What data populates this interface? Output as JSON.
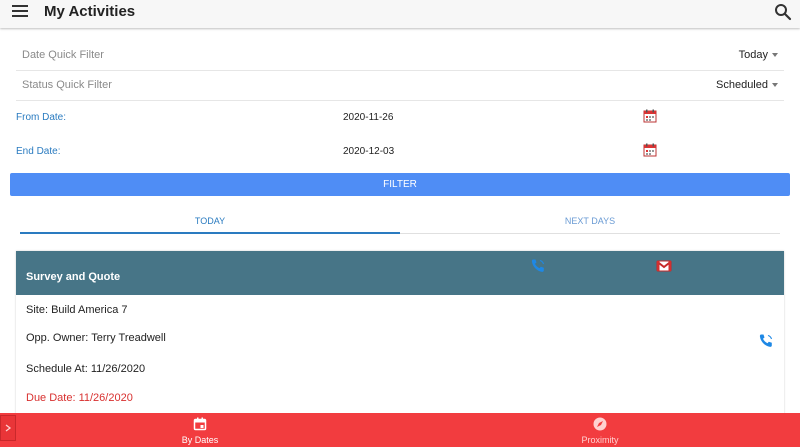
{
  "app": {
    "title": "My Activities"
  },
  "icons": {
    "menu": "menu-icon",
    "search": "search-icon",
    "calendar": "calendar-icon",
    "phone": "phone-icon",
    "mail": "mail-icon",
    "by_dates": "calendar-icon",
    "proximity": "compass-icon",
    "drawer": "chevron-right-icon"
  },
  "filters": {
    "date_quick": {
      "label": "Date Quick Filter",
      "value": "Today"
    },
    "status_quick": {
      "label": "Status Quick Filter",
      "value": "Scheduled"
    },
    "from_date": {
      "label": "From Date:",
      "value": "2020-11-26"
    },
    "end_date": {
      "label": "End Date:",
      "value": "2020-12-03"
    },
    "filter_button": "FILTER"
  },
  "tabs": [
    {
      "label": "TODAY",
      "active": true
    },
    {
      "label": "NEXT DAYS",
      "active": false
    }
  ],
  "card": {
    "title": "Survey and Quote",
    "site": "Site: Build America 7",
    "owner": "Opp. Owner: Terry Treadwell",
    "schedule": "Schedule At: 11/26/2020",
    "due": "Due Date: 11/26/2020"
  },
  "bottom_nav": [
    {
      "label": "By Dates",
      "active": true
    },
    {
      "label": "Proximity",
      "active": false
    }
  ],
  "colors": {
    "primary": "#4f8df5",
    "card_header": "#477587",
    "bottom_nav": "#f23c3f",
    "link": "#2a7bc0",
    "due_text": "#d8302f"
  }
}
